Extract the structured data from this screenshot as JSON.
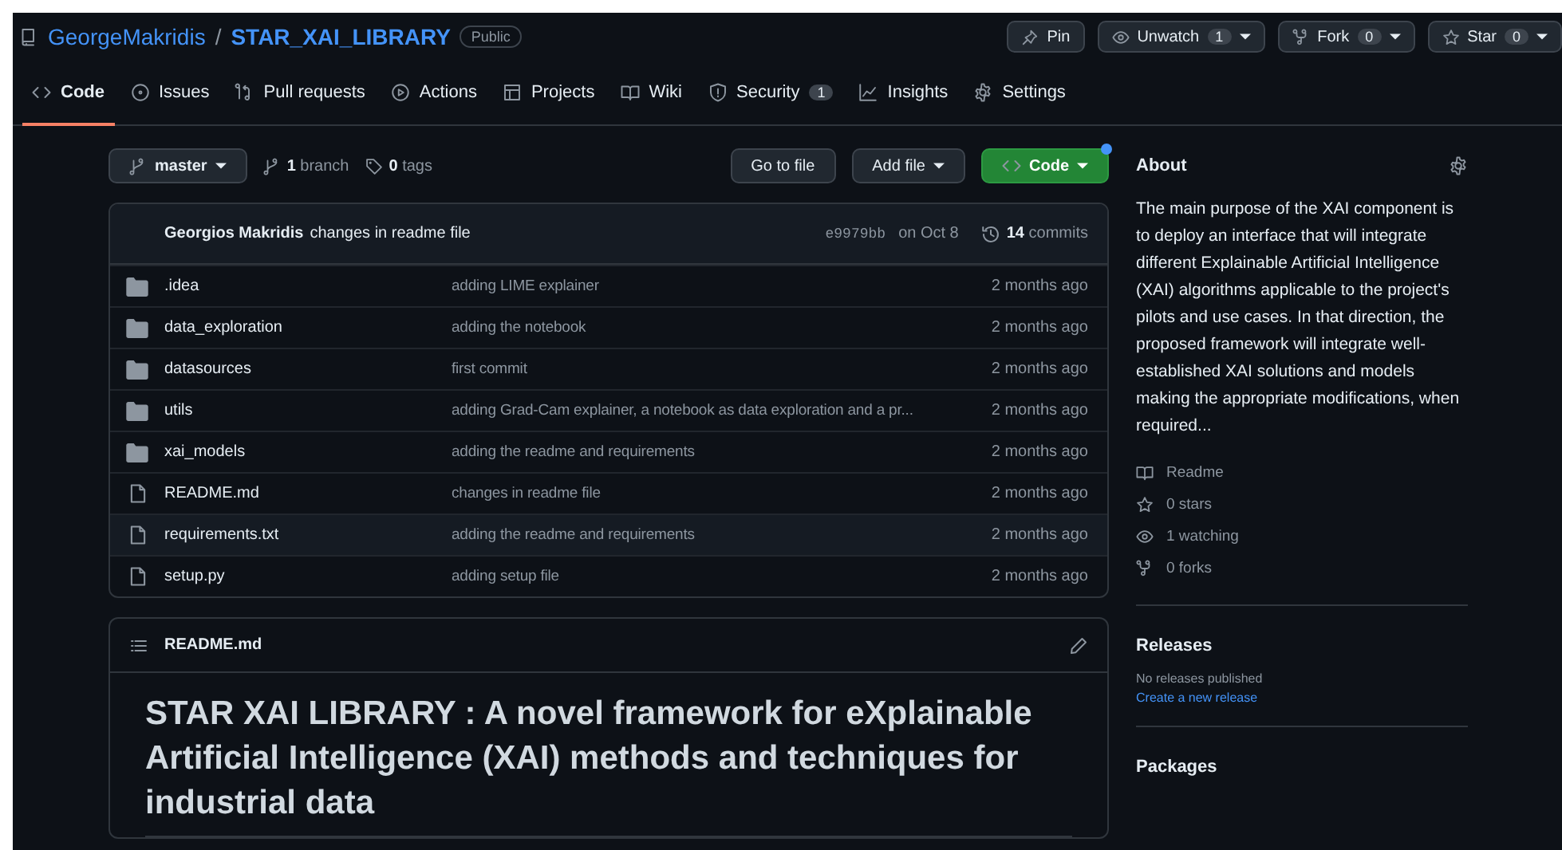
{
  "repo": {
    "owner": "GeorgeMakridis",
    "separator": "/",
    "name": "STAR_XAI_LIBRARY",
    "visibility": "Public"
  },
  "actions": [
    {
      "kind": "pin",
      "label": "Pin"
    },
    {
      "kind": "watch",
      "label": "Unwatch",
      "count": "1"
    },
    {
      "kind": "fork",
      "label": "Fork",
      "count": "0"
    },
    {
      "kind": "star",
      "label": "Star",
      "count": "0"
    }
  ],
  "tabs": [
    {
      "kind": "code",
      "label": "Code",
      "selected": true
    },
    {
      "kind": "issues",
      "label": "Issues",
      "selected": false
    },
    {
      "kind": "pull",
      "label": "Pull requests",
      "selected": false
    },
    {
      "kind": "actions",
      "label": "Actions",
      "selected": false
    },
    {
      "kind": "projects",
      "label": "Projects",
      "selected": false
    },
    {
      "kind": "wiki",
      "label": "Wiki",
      "selected": false
    },
    {
      "kind": "security",
      "label": "Security",
      "counter": "1",
      "selected": false
    },
    {
      "kind": "insights",
      "label": "Insights",
      "selected": false
    },
    {
      "kind": "settings",
      "label": "Settings",
      "selected": false
    }
  ],
  "branch_bar": {
    "branch": "master",
    "branches": "**1** branch",
    "tags": "**0** tags",
    "buttons": [
      {
        "kind": "plain",
        "label": "Go to file"
      },
      {
        "kind": "dropdown",
        "label": "Add file"
      },
      {
        "kind": "primary",
        "label": "Code",
        "notification": true
      }
    ]
  },
  "latest_commit": {
    "author": "Georgios Makridis",
    "message": "changes in readme file",
    "hash": "e9979bb",
    "date": "on Oct 8",
    "commits": "**14** commits"
  },
  "files": [
    {
      "kind": "folder",
      "name": ".idea",
      "message": "adding LIME explainer",
      "age": "2 months ago",
      "highlighted": false
    },
    {
      "kind": "folder",
      "name": "data_exploration",
      "message": "adding the notebook",
      "age": "2 months ago",
      "highlighted": false
    },
    {
      "kind": "folder",
      "name": "datasources",
      "message": "first commit",
      "age": "2 months ago",
      "highlighted": false
    },
    {
      "kind": "folder",
      "name": "utils",
      "message": "adding Grad-Cam explainer, a notebook as data exploration and a pr...",
      "age": "2 months ago",
      "highlighted": false
    },
    {
      "kind": "folder",
      "name": "xai_models",
      "message": "adding the readme and requirements",
      "age": "2 months ago",
      "highlighted": false
    },
    {
      "kind": "file",
      "name": "README.md",
      "message": "changes in readme file",
      "age": "2 months ago",
      "highlighted": false
    },
    {
      "kind": "file",
      "name": "requirements.txt",
      "message": "adding the readme and requirements",
      "age": "2 months ago",
      "highlighted": true
    },
    {
      "kind": "file",
      "name": "setup.py",
      "message": "adding setup file",
      "age": "2 months ago",
      "highlighted": false
    }
  ],
  "readme": {
    "file": "README.md",
    "heading": "STAR XAI LIBRARY : A novel framework for eXplainable Artificial Intelligence (XAI) methods and techniques for industrial data"
  },
  "about": {
    "title": "About",
    "description": "The main purpose of the XAI component is to deploy an interface that will integrate different Explainable Artificial Intelligence (XAI) algorithms applicable to the project's pilots and use cases. In that direction, the proposed framework will integrate well-established XAI solutions and models making the appropriate modifications, when required...",
    "links": [
      {
        "kind": "book",
        "label": "Readme"
      },
      {
        "kind": "star",
        "label": "0 stars"
      },
      {
        "kind": "eye",
        "label": "1 watching"
      },
      {
        "kind": "fork",
        "label": "0 forks"
      }
    ]
  },
  "releases": {
    "title": "Releases",
    "note": "No releases published",
    "link": "Create a new release"
  },
  "packages": {
    "title": "Packages"
  }
}
